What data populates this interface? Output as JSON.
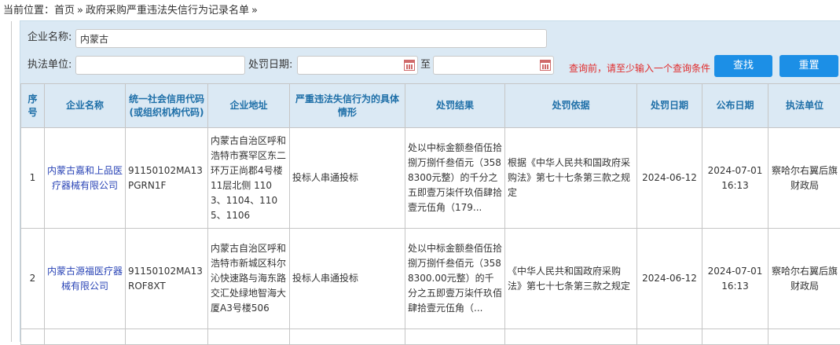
{
  "breadcrumb": {
    "prefix": "当前位置：",
    "home": "首页",
    "separator": "»",
    "current": "政府采购严重违法失信行为记录名单",
    "trail": "»"
  },
  "search": {
    "company_label": "企业名称:",
    "company_value": "内蒙古",
    "agency_label": "执法单位:",
    "agency_value": "",
    "date_label": "处罚日期:",
    "date_from": "",
    "date_to_label": "至",
    "date_to": "",
    "hint": "查询前，请至少输入一个查询条件",
    "search_button": "查找",
    "reset_button": "重置",
    "icons": {
      "calendar": "calendar-icon"
    }
  },
  "table": {
    "headers": [
      "序号",
      "企业名称",
      "统一社会信用代码(或组织机构代码)",
      "企业地址",
      "严重违法失信行为的具体情形",
      "处罚结果",
      "处罚依据",
      "处罚日期",
      "公布日期",
      "执法单位"
    ],
    "rows": [
      {
        "index": "1",
        "company": "内蒙古嘉和上品医疗器械有限公司",
        "credit_code": "91150102MA13PGRN1F",
        "address": "内蒙古自治区呼和浩特市赛罕区东二环万正尚郡4号楼11层北侧 1103、1104、1105、1106",
        "behavior": "投标人串通投标",
        "result": "处以中标金额叁佰伍拾捌万捌仟叁佰元（3588300元整）的千分之五即壹万柒仟玖佰肆拾壹元伍角（179...",
        "basis": "根据《中华人民共和国政府采购法》第七十七条第三款之规定",
        "penalty_date": "2024-06-12",
        "publish_date": "2024-07-01 16:13",
        "agency": "察哈尔右翼后旗财政局"
      },
      {
        "index": "2",
        "company": "内蒙古源福医疗器械有限公司",
        "credit_code": "91150102MA13ROF8XT",
        "address": "内蒙古自治区呼和浩特市新城区科尔沁快速路与海东路交汇处绿地智海大厦A3号楼506",
        "behavior": "投标人串通投标",
        "result": "处以中标金额叁佰伍拾捌万捌仟叁佰元（3588300.00元整）的千分之五即壹万柒仟玖佰肆拾壹元伍角（...",
        "basis": "《中华人民共和国政府采购法》第七十七条第三款之规定",
        "penalty_date": "2024-06-12",
        "publish_date": "2024-07-01 16:13",
        "agency": "察哈尔右翼后旗财政局"
      }
    ]
  }
}
